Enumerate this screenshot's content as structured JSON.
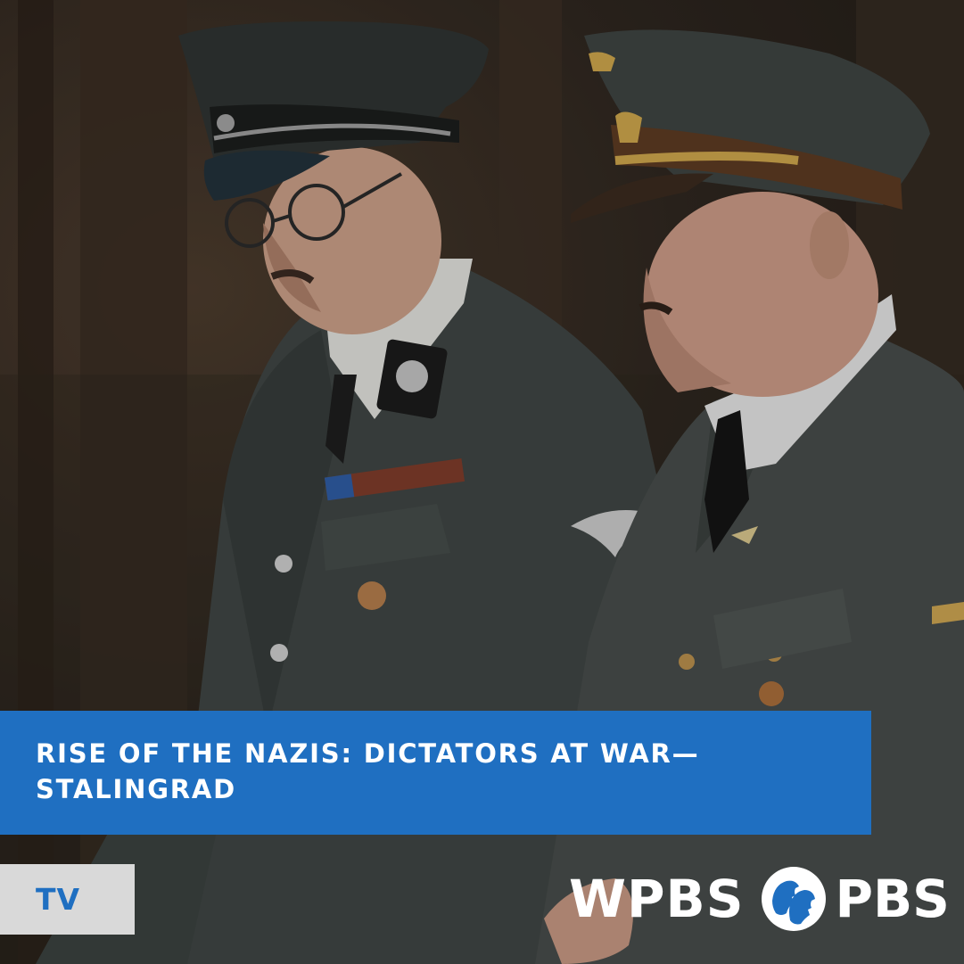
{
  "title": {
    "line1": "RISE OF THE NAZIS: DICTATORS AT WAR—",
    "line2": "STALINGRAD"
  },
  "category": {
    "label": "TV"
  },
  "branding": {
    "station": "WPBS",
    "network": "PBS",
    "logo_icon": "pbs-heads-logo-icon"
  },
  "colors": {
    "banner": "#1f6fc1",
    "badge_background": "#d9d9d9",
    "badge_text": "#1f6fc1",
    "brand_text": "#ffffff"
  },
  "photo": {
    "subject": "two-uniformed-officers-walking-in-forest"
  }
}
